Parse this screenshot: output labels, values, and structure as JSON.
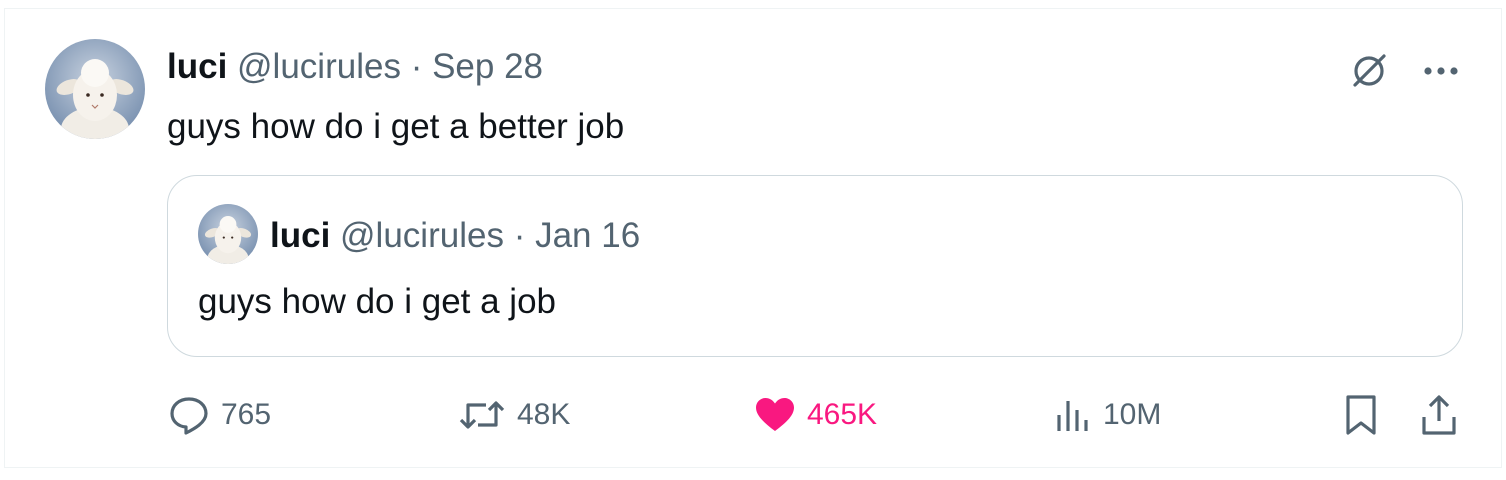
{
  "tweet": {
    "author_name": "luci",
    "author_handle": "@lucirules",
    "separator": "·",
    "date": "Sep 28",
    "text": "guys how do i get a better job",
    "avatar_icon": "lamb-plush-avatar"
  },
  "quoted_tweet": {
    "author_name": "luci",
    "author_handle": "@lucirules",
    "separator": "·",
    "date": "Jan 16",
    "text": "guys how do i get a job",
    "avatar_icon": "lamb-plush-avatar"
  },
  "top_icons": [
    "grok-icon",
    "more-options-icon"
  ],
  "actions": {
    "replies": "765",
    "retweets": "48K",
    "likes": "465K",
    "views": "10M"
  },
  "colors": {
    "text": "#0f1419",
    "muted": "#536471",
    "like": "#f91880",
    "border": "#cfd9de"
  }
}
